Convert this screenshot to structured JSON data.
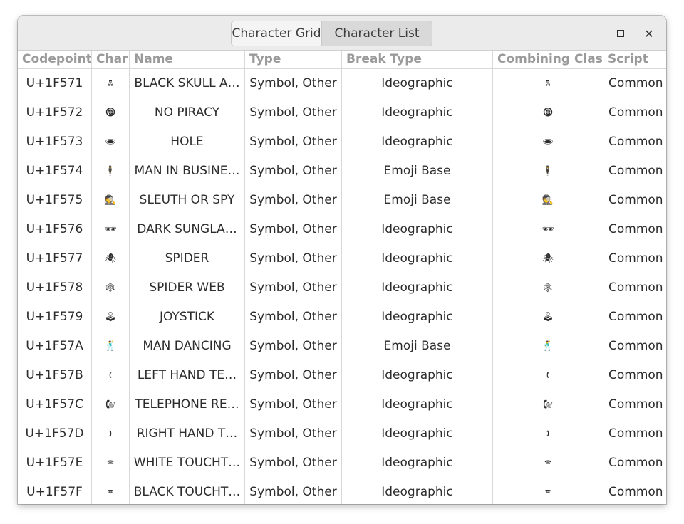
{
  "header": {
    "tabs": [
      "Character Grid",
      "Character List"
    ],
    "selected_tab": "Character List"
  },
  "window_controls": {
    "minimize": "–",
    "maximize": "□",
    "close": "×"
  },
  "table": {
    "columns": [
      "Codepoint",
      "Char",
      "Name",
      "Type",
      "Break Type",
      "Combining Class",
      "Script"
    ],
    "rows": [
      [
        "U+1F571",
        "🕱",
        "BLACK SKULL A…",
        "Symbol, Other",
        "Ideographic",
        "🕱",
        "Common"
      ],
      [
        "U+1F572",
        "🕲",
        "NO PIRACY",
        "Symbol, Other",
        "Ideographic",
        "🕲",
        "Common"
      ],
      [
        "U+1F573",
        "🕳",
        "HOLE",
        "Symbol, Other",
        "Ideographic",
        "🕳",
        "Common"
      ],
      [
        "U+1F574",
        "🕴",
        "MAN IN BUSINE…",
        "Symbol, Other",
        "Emoji Base",
        "🕴",
        "Common"
      ],
      [
        "U+1F575",
        "🕵",
        "SLEUTH OR SPY",
        "Symbol, Other",
        "Emoji Base",
        "🕵",
        "Common"
      ],
      [
        "U+1F576",
        "🕶",
        "DARK SUNGLA…",
        "Symbol, Other",
        "Ideographic",
        "🕶",
        "Common"
      ],
      [
        "U+1F577",
        "🕷",
        "SPIDER",
        "Symbol, Other",
        "Ideographic",
        "🕷",
        "Common"
      ],
      [
        "U+1F578",
        "🕸",
        "SPIDER WEB",
        "Symbol, Other",
        "Ideographic",
        "🕸",
        "Common"
      ],
      [
        "U+1F579",
        "🕹",
        "JOYSTICK",
        "Symbol, Other",
        "Ideographic",
        "🕹",
        "Common"
      ],
      [
        "U+1F57A",
        "🕺",
        "MAN DANCING",
        "Symbol, Other",
        "Emoji Base",
        "🕺",
        "Common"
      ],
      [
        "U+1F57B",
        "🕻",
        "LEFT HAND TE…",
        "Symbol, Other",
        "Ideographic",
        "🕻",
        "Common"
      ],
      [
        "U+1F57C",
        "🕼",
        "TELEPHONE RE…",
        "Symbol, Other",
        "Ideographic",
        "🕼",
        "Common"
      ],
      [
        "U+1F57D",
        "🕽",
        "RIGHT HAND T…",
        "Symbol, Other",
        "Ideographic",
        "🕽",
        "Common"
      ],
      [
        "U+1F57E",
        "🕾",
        "WHITE TOUCHT…",
        "Symbol, Other",
        "Ideographic",
        "🕾",
        "Common"
      ],
      [
        "U+1F57F",
        "🕿",
        "BLACK TOUCHT…",
        "Symbol, Other",
        "Ideographic",
        "🕿",
        "Common"
      ]
    ]
  }
}
